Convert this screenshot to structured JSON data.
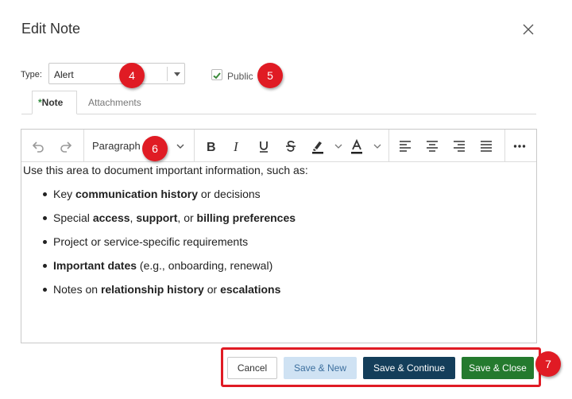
{
  "dialog": {
    "title": "Edit Note"
  },
  "form": {
    "type_label": "Type:",
    "type_value": "Alert",
    "public_label": "Public",
    "public_checked": true
  },
  "tabs": [
    {
      "required_mark": "*",
      "label": "Note",
      "active": true
    },
    {
      "label": "Attachments",
      "active": false
    }
  ],
  "toolbar": {
    "paragraph_label": "Paragraph",
    "icons": [
      "undo-icon",
      "redo-icon",
      "chevron-down-icon",
      "bold-icon",
      "italic-icon",
      "underline-icon",
      "strikethrough-icon",
      "highlight-icon",
      "font-color-icon",
      "align-left-icon",
      "align-center-icon",
      "align-right-icon",
      "justify-icon",
      "more-icon"
    ]
  },
  "editor": {
    "intro": "Use this area to document important information, such as:",
    "bullets": [
      {
        "a": "Key ",
        "b1": "communication history",
        "c": " or decisions",
        "b2": "",
        "d": "",
        "b3": "",
        "e": ""
      },
      {
        "a": "Special ",
        "b1": "access",
        "c": ", ",
        "b2": "support",
        "d": ", or ",
        "b3": "billing preferences",
        "e": ""
      },
      {
        "a": "Project or service-specific requirements",
        "b1": "",
        "c": "",
        "b2": "",
        "d": "",
        "b3": "",
        "e": ""
      },
      {
        "a": "",
        "b1": "Important dates",
        "c": " (e.g., onboarding, renewal)",
        "b2": "",
        "d": "",
        "b3": "",
        "e": ""
      },
      {
        "a": "Notes on ",
        "b1": "relationship history",
        "c": " or ",
        "b2": "escalations",
        "d": "",
        "b3": "",
        "e": ""
      }
    ]
  },
  "buttons": {
    "cancel": "Cancel",
    "save_new": "Save & New",
    "save_continue": "Save & Continue",
    "save_close": "Save & Close"
  },
  "callouts": [
    "4",
    "5",
    "6",
    "7"
  ],
  "colors": {
    "callout": "#e01b24",
    "primary_dark": "#143e5a",
    "success": "#247a2e",
    "light_blue": "#cfe2f3"
  }
}
